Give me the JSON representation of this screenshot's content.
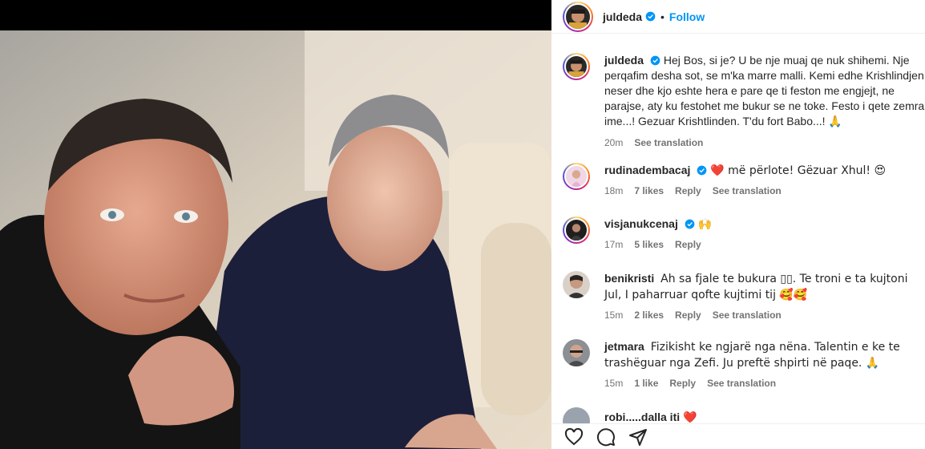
{
  "post": {
    "username": "juldeda",
    "follow_label": "Follow",
    "dot": "•",
    "caption": "Hej Bos, si je? U be nje muaj qe nuk shihemi. Nje perqafim desha sot, se m'ka marre malli. Kemi edhe Krishlindjen neser dhe kjo eshte hera e pare qe ti feston me engjejt, ne parajse, aty ku festohet me bukur se ne toke. Festo i qete zemra ime...! Gezuar Krishtlinden. T'du fort Babo...! 🙏",
    "caption_time": "20m",
    "see_translation": "See translation"
  },
  "comments": [
    {
      "username": "rudinadembacaj",
      "text": "❤️ më përlote! Gëzuar Xhul! 😍",
      "time": "18m",
      "likes": "7 likes",
      "reply": "Reply",
      "translation": "See translation"
    },
    {
      "username": "visjanukcenaj",
      "text": "🙌",
      "time": "17m",
      "likes": "5 likes",
      "reply": "Reply",
      "translation": ""
    },
    {
      "username": "benikristi",
      "text": "Ah sa fjale te bukura ▯▯. Te troni e ta kujtoni Jul, I paharruar qofte kujtimi tij 🥰🥰",
      "time": "15m",
      "likes": "2 likes",
      "reply": "Reply",
      "translation": "See translation"
    },
    {
      "username": "jetmara",
      "text": "Fizikisht ke ngjarë nga nëna. Talentin e ke te trashëguar nga Zefi. Ju preftë shpirti në paqe. 🙏",
      "time": "15m",
      "likes": "1 like",
      "reply": "Reply",
      "translation": "See translation"
    }
  ],
  "partial_comment": "robi.....dalla iti ❤️",
  "icons": {
    "like": "heart-icon",
    "comment": "comment-icon",
    "share": "share-icon",
    "verified": "verified-badge-icon"
  },
  "colors": {
    "link": "#0095f6",
    "verified": "#0095f6",
    "muted": "#737373"
  }
}
